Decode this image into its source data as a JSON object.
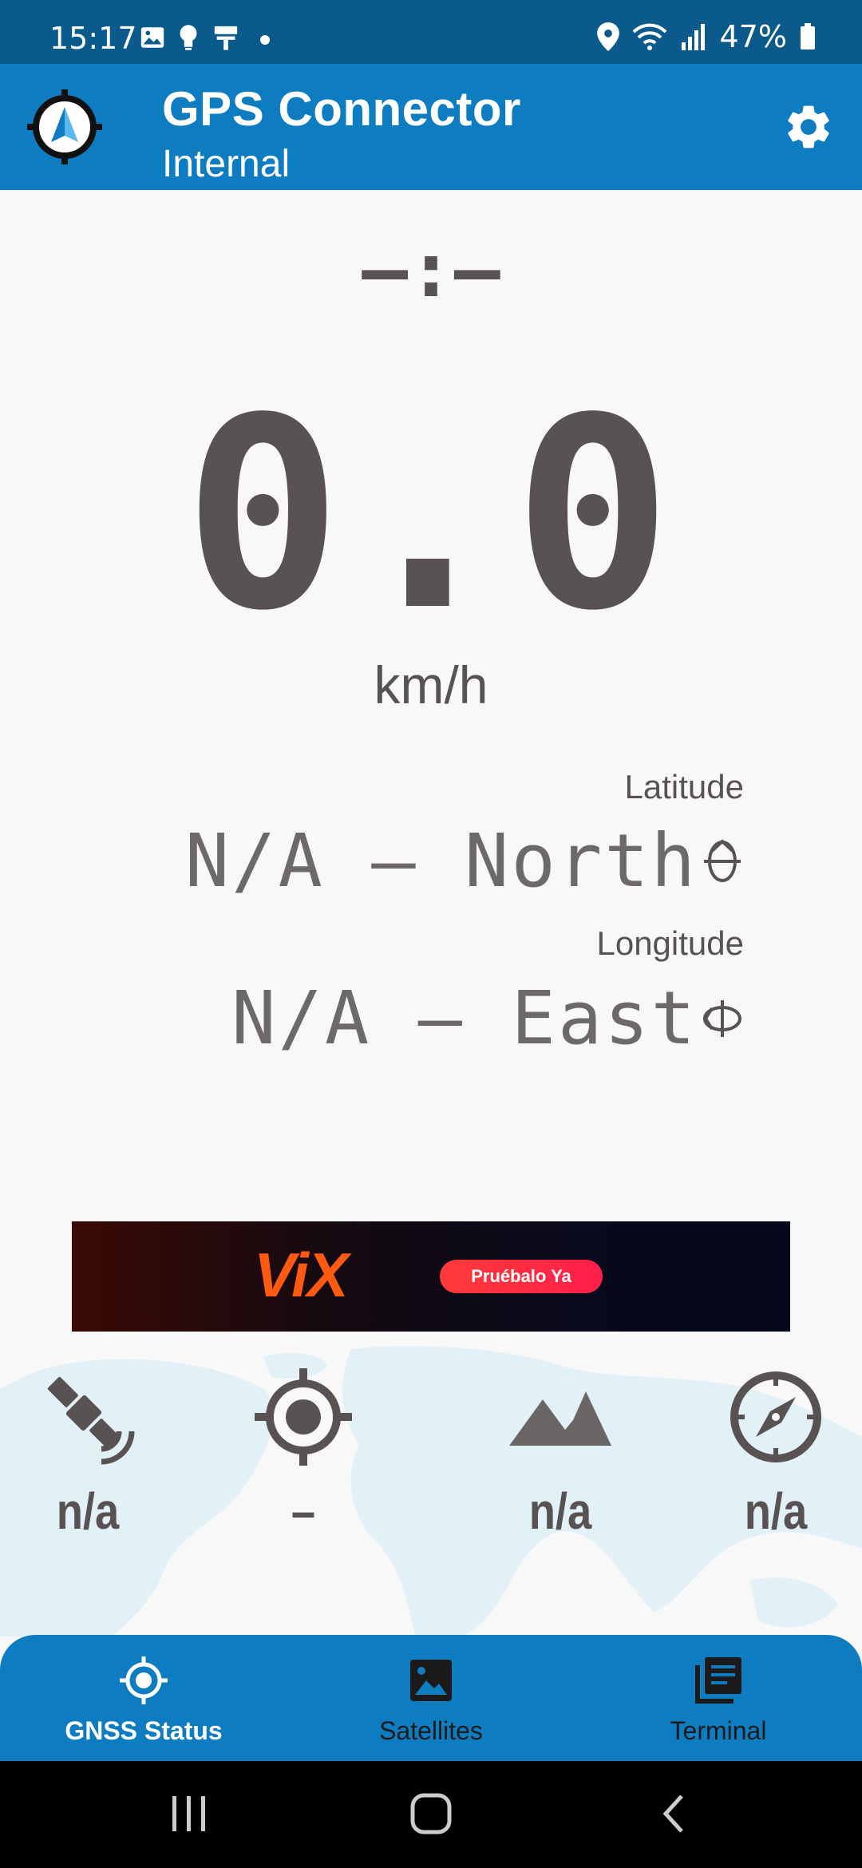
{
  "status_bar": {
    "time": "15:17",
    "battery": "47%",
    "icons": [
      "gallery-icon",
      "bulb-icon",
      "roller-icon",
      "dot-icon",
      "location-icon",
      "wifi-icon",
      "signal-icon",
      "battery-icon"
    ]
  },
  "app_bar": {
    "title": "GPS Connector",
    "subtitle": "Internal",
    "icons": [
      "app-logo-icon",
      "settings-icon"
    ]
  },
  "main": {
    "time": "–:–",
    "speed": "0.0",
    "speed_unit": "km/h",
    "latitude_label": "Latitude",
    "latitude_value": "N/A – North",
    "longitude_label": "Longitude",
    "longitude_value": "N/A – East"
  },
  "ad": {
    "brand": "ViX",
    "cta": "Pruébalo Ya"
  },
  "stats": [
    {
      "icon": "satellite-icon",
      "value": "n/a"
    },
    {
      "icon": "crosshair-icon",
      "value": "–"
    },
    {
      "icon": "mountain-icon",
      "value": "n/a"
    },
    {
      "icon": "compass-icon",
      "value": "n/a"
    }
  ],
  "bottom_nav": [
    {
      "label": "GNSS Status",
      "icon": "gps-fixed-icon",
      "active": true
    },
    {
      "label": "Satellites",
      "icon": "image-icon",
      "active": false
    },
    {
      "label": "Terminal",
      "icon": "library-books-icon",
      "active": false
    }
  ],
  "system_nav": [
    "recents-icon",
    "home-icon",
    "back-icon"
  ],
  "colors": {
    "status_bar": "#0b5a8c",
    "app_bar": "#0d7cc0",
    "text_dark": "#585252",
    "background": "#f8f8f8"
  }
}
